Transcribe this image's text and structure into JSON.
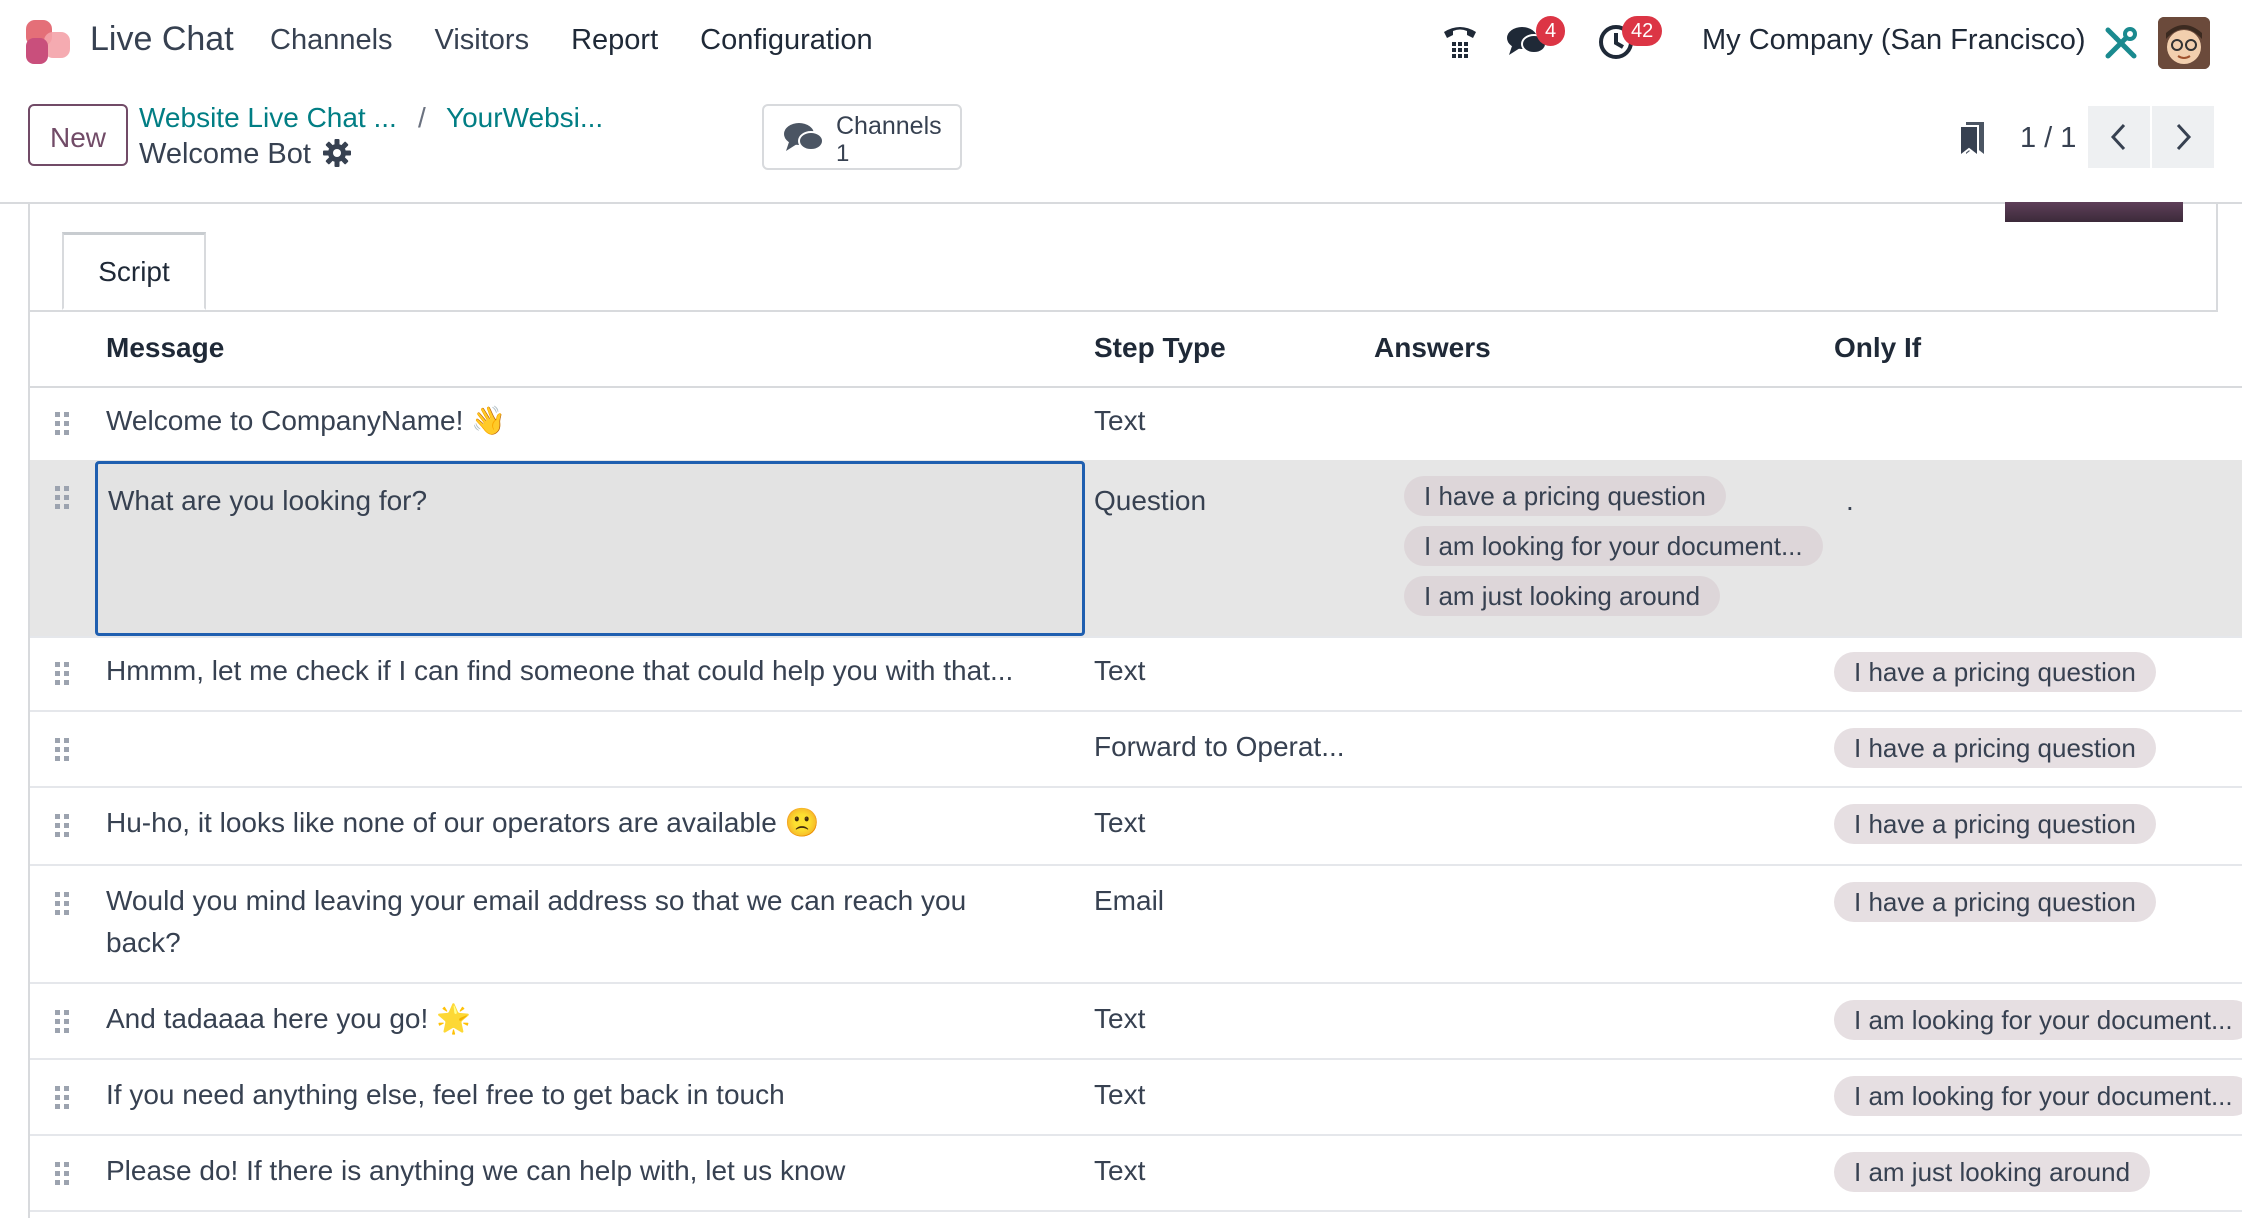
{
  "navbar": {
    "app_name": "Live Chat",
    "menu": [
      "Channels",
      "Visitors",
      "Report",
      "Configuration"
    ],
    "messages_badge": "4",
    "activity_badge": "42",
    "company": "My Company (San Francisco)"
  },
  "control": {
    "new_label": "New",
    "breadcrumb_1": "Website Live Chat ...",
    "breadcrumb_sep": "/",
    "breadcrumb_2": "YourWebsi...",
    "record_title": "Welcome Bot",
    "smart_button": {
      "label": "Channels",
      "value": "1"
    },
    "pager": "1 / 1"
  },
  "tabs": [
    "Script"
  ],
  "table": {
    "headers": {
      "message": "Message",
      "step_type": "Step Type",
      "answers": "Answers",
      "only_if": "Only If"
    },
    "rows": [
      {
        "message": "Welcome to CompanyName! 👋",
        "step_type": "Text",
        "answers": [],
        "only_if": ""
      },
      {
        "message": "What are you looking for?",
        "step_type": "Question",
        "answers": [
          "I have a pricing question",
          "I am looking for your document...",
          "I am just looking around"
        ],
        "only_if": "."
      },
      {
        "message": "Hmmm, let me check if I can find someone that could help you with that...",
        "step_type": "Text",
        "answers": [],
        "only_if": "I have a pricing question"
      },
      {
        "message": "",
        "step_type": "Forward to Operat...",
        "answers": [],
        "only_if": "I have a pricing question"
      },
      {
        "message": "Hu-ho, it looks like none of our operators are available 🙁",
        "step_type": "Text",
        "answers": [],
        "only_if": "I have a pricing question"
      },
      {
        "message": "Would you mind leaving your email address so that we can reach you back?",
        "step_type": "Email",
        "answers": [],
        "only_if": "I have a pricing question"
      },
      {
        "message": "And tadaaaa here you go! 🌟",
        "step_type": "Text",
        "answers": [],
        "only_if": "I am looking for your document..."
      },
      {
        "message": "If you need anything else, feel free to get back in touch",
        "step_type": "Text",
        "answers": [],
        "only_if": "I am looking for your document..."
      },
      {
        "message": "Please do! If there is anything we can help with, let us know",
        "step_type": "Text",
        "answers": [],
        "only_if": "I am just looking around"
      }
    ]
  }
}
